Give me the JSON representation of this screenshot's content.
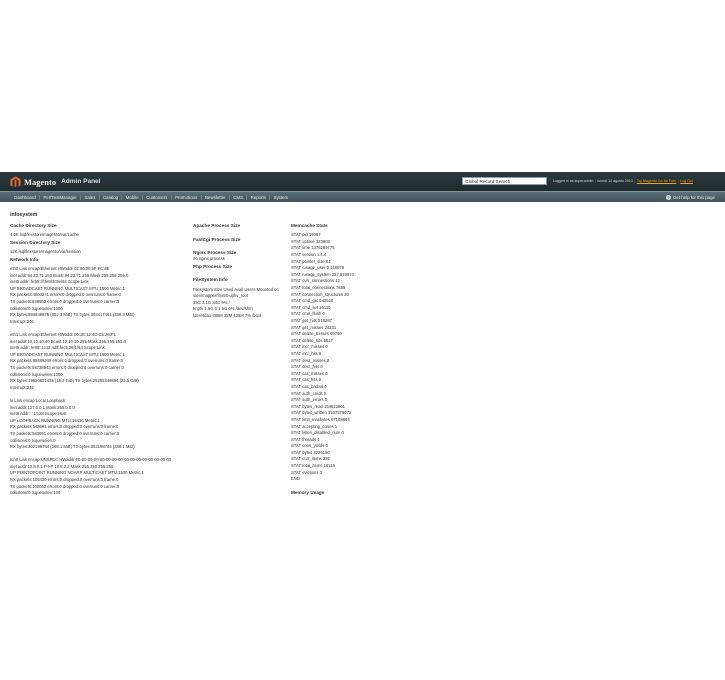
{
  "header": {
    "logo_text": "Magento",
    "logo_sub": "Admin Panel",
    "search_value": "Global Record Search",
    "logged_in": "Logged in as superadmin",
    "date": "lunedì 12 agosto 2013",
    "tour_link": "Try Magento Go for Free",
    "logout": "Log Out"
  },
  "nav": {
    "items": [
      "Dashboard",
      "PerfTestManager",
      "Sales",
      "Catalog",
      "Mobile",
      "Customers",
      "Promotions",
      "Newsletter",
      "CMS",
      "Reports",
      "System"
    ],
    "help": "Get help for this page"
  },
  "page": {
    "title": "infosystem"
  },
  "col1": {
    "cache_dir_title": "Cache Directory Size",
    "cache_dir_value": "4.6K /sql/lexstore/magento/var/cache",
    "session_dir_title": "Session Directory Size",
    "session_dir_value": "12K /sql/lexstore/magento/var/session",
    "network_title": "Network Info",
    "eth0": [
      "eth0 Link encap:Ethernet HWaddr 02:00:00:5F:FC:8E",
      "inet addr:94.23.71.153 Bcast:94.23.71.255 Mask:255.255.255.0",
      "inet6 addr: fe80::ff:fe5f:fc8e/64 Scope:Link",
      "UP BROADCAST RUNNING MULTICAST MTU:1500 Metric:1",
      "RX packets:4004271 errors:0 dropped:0 overruns:0 frame:0",
      "TX packets:838553 errors:0 dropped:0 overruns:0 carrier:0",
      "collisions:0 txqueuelen:1000",
      "RX bytes:894848875 (852.3 MiB) TX bytes:303417464 (289.3 MiB)",
      "Interrupt:246"
    ],
    "eth1": [
      "eth1 Link encap:Ethernet HWaddr 00:1E:12:4D:C5:26:F1",
      "inet addr:10.10.10.40 Bcast:10.10.10.255 Mask:255.255.255.0",
      "inet6 addr: fe80::1c12:4dff:fec5:26f1/64 Scope:Link",
      "UP BROADCAST RUNNING MULTICAST MTU:1500 Metric:1",
      "RX packets:85489349 errors:0 dropped:0 overruns:0 frame:0",
      "TX packets:58738943 errors:0 dropped:0 overruns:0 carrier:0",
      "collisions:0 txqueuelen:1000",
      "RX bytes:19620831435 (18.2 GiB) TX bytes:25265349864 (23.5 GiB)",
      "Interrupt:245"
    ],
    "lo": [
      "lo Link encap:Local Loopback",
      "inet addr:127.0.0.1 Mask:255.0.0.0",
      "inet6 addr: ::1/128 Scope:Host",
      "UP LOOPBACK RUNNING MTU:16436 Metric:1",
      "RX packets:543691 errors:0 dropped:0 overruns:0 frame:0",
      "TX packets:543691 errors:0 dropped:0 overruns:0 carrier:0",
      "collisions:0 txqueuelen:0",
      "RX bytes:302198784 (288.1 MiB) TX bytes:302198784 (288.1 MiB)"
    ],
    "tun0": [
      "tun0 Link encap:UNSPEC HWaddr 00-00-00-00-00-00-00-00-00-00-00-00-00-00-00-00",
      "inet addr:10.8.0.1 P-t-P:10.8.0.2 Mask:255.255.255.255",
      "UP POINTOPOINT RUNNING NOARP MULTICAST MTU:1500 Metric:1",
      "RX packets:105430 errors:0 dropped:0 overruns:0 frame:0",
      "TX packets:100043 errors:0 dropped:0 overruns:0 carrier:0",
      "collisions:0 txqueuelen:100"
    ]
  },
  "col2": {
    "apache_title": "Apache Process Size",
    "fastcgi_title": "FastCgi Process Size",
    "nginx_title": "Nginx Process Size",
    "nginx_value": "no nginx process",
    "php_title": "Php Process Size",
    "fs_title": "FileSystem Info",
    "fs_lines": [
      "Filesystem Size Used Avail Use% Mounted on",
      "/dev/mapper/foo50-uphv_root",
      "39G 3.1G 34G 9% /",
      "tmpfs 1.5G 0 1.5G 0% /dev/shm",
      "/dev/sda1 485M 32M 428M 7% /boot"
    ]
  },
  "col3": {
    "memcache_title": "Memcache Stats",
    "memcache_lines": [
      "STAT pid 19087",
      "STAT uptime 323803",
      "STAT time 1376289775",
      "STAT version 1.4.4",
      "STAT pointer_size 64",
      "STAT rusage_user 0.146978",
      "STAT rusage_system 337.519974",
      "STAT curr_connections 12",
      "STAT total_connections 7859",
      "STAT connection_structures 30",
      "STAT cmd_get 542518",
      "STAT cmd_set 16110",
      "STAT cmd_flush 0",
      "STAT get_hits 518287",
      "STAT get_misses 24231",
      "STAT delete_misses 69780",
      "STAT delete_hits 6617",
      "STAT incr_misses 0",
      "STAT incr_hits 0",
      "STAT decr_misses 0",
      "STAT decr_hits 0",
      "STAT cas_misses 0",
      "STAT cas_hits 0",
      "STAT cas_badval 0",
      "STAT auth_cmds 0",
      "STAT auth_errors 0",
      "STAT bytes_read 154622901",
      "STAT bytes_written 3167579072",
      "STAT limit_maxbytes 67108864",
      "STAT accepting_conns 1",
      "STAT listen_disabled_num 0",
      "STAT threads 4",
      "STAT conn_yields 0",
      "STAT bytes 3226150",
      "STAT curr_items 326",
      "STAT total_items 16115",
      "STAT evictions 0",
      "END"
    ],
    "memory_title": "Memory Usage"
  }
}
